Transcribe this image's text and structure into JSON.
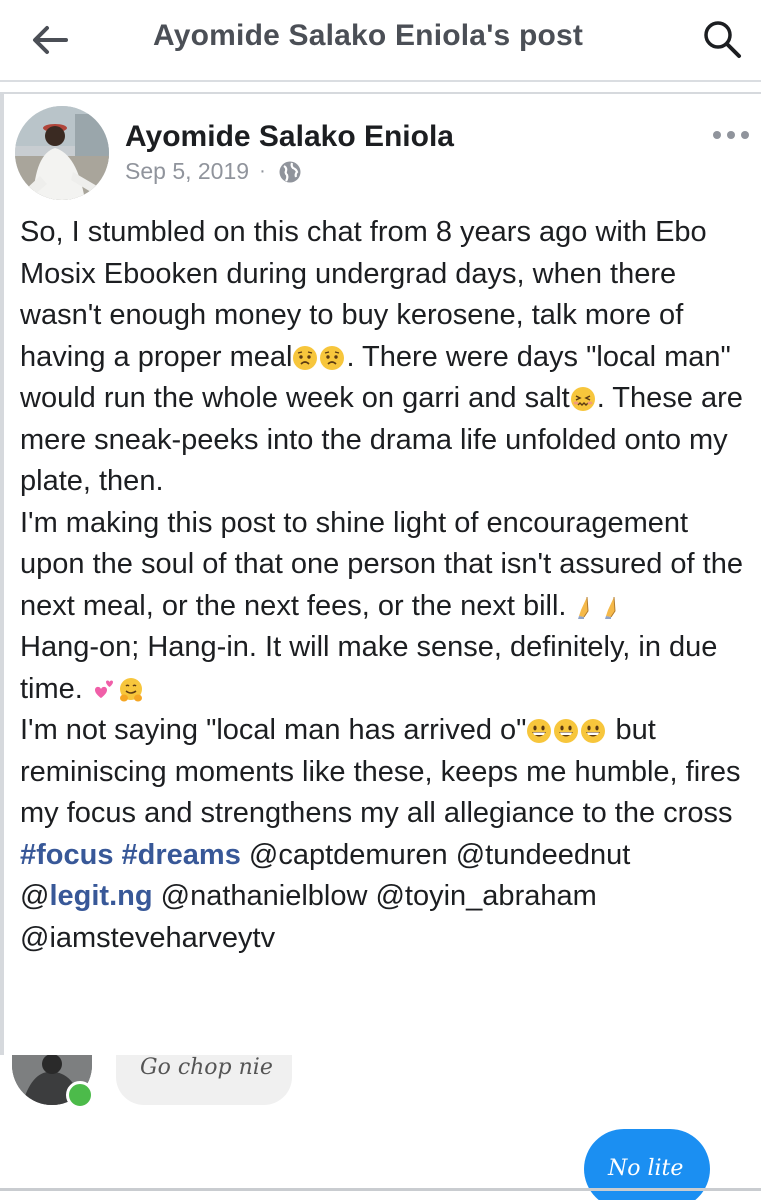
{
  "topbar": {
    "title": "Ayomide Salako Eniola's post",
    "back_icon": "arrow-left-icon",
    "search_icon": "search-icon"
  },
  "post": {
    "author": "Ayomide Salako Eniola",
    "date": "Sep 5, 2019",
    "separator": "·",
    "privacy_icon": "globe-icon",
    "more_icon": "more-horizontal-icon",
    "lines": {
      "p1_a": "So, I stumbled on this chat from 8 years ago with Ebo Mosix Ebooken during undergrad days, when there wasn't enough money to buy kerosene, talk more of having a proper meal",
      "p1_b": ". There were days \"local man\" would run the whole week on garri and salt",
      "p1_c": ". These are mere sneak-peeks into the drama life unfolded onto my plate, then.",
      "p2": "I'm making this post to shine light of encouragement upon the soul of that one person that isn't assured of the next meal, or the next fees, or the next bill. ",
      "p3": "Hang-on; Hang-in. It will make sense, definitely, in due time. ",
      "p4_a": "I'm not saying \"local man has arrived o\"",
      "p4_b": " but reminiscing moments like these, keeps me humble, fires my focus and strengthens my all allegiance to the cross",
      "hashtags": [
        "#focus",
        "#dreams"
      ],
      "mentions": {
        "captdemuren": "@captdemuren",
        "tundeednut": "@tundeednut",
        "legit_at": "@",
        "legit_link": "legit.ng",
        "nathanielblow": "@nathanielblow",
        "toyin_abraham": "@toyin_abraham",
        "iamsteveharveytv": "@iamsteveharveytv"
      }
    },
    "emojis": {
      "worried": "worried-face-emoji",
      "confounded": "confounded-face-emoji",
      "folded_hands": "folded-hands-emoji",
      "two_hearts": "two-hearts-emoji",
      "hugging": "hugging-face-emoji",
      "grinning": "grinning-face-emoji"
    }
  },
  "chat_image": {
    "left_message": "Go chop nie",
    "right_message": "No lite"
  },
  "colors": {
    "link": "#385898",
    "text": "#1c1e21",
    "meta": "#90949c",
    "bubble_blue": "#1b8ff2",
    "online_green": "#4cbb4a"
  }
}
